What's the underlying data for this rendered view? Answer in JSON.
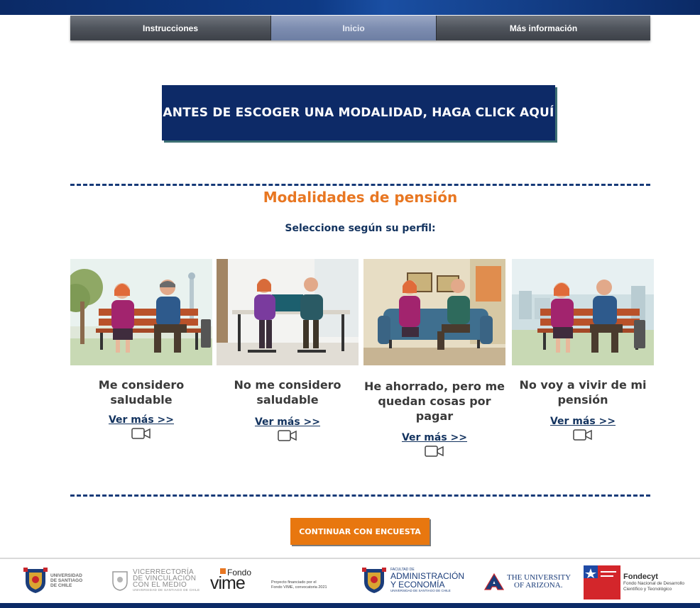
{
  "nav": {
    "items": [
      {
        "label": "Instrucciones"
      },
      {
        "label": "Inicio"
      },
      {
        "label": "Más información"
      }
    ],
    "active_index": 1
  },
  "cta_top": {
    "label": "ANTES DE ESCOGER UNA MODALIDAD, HAGA CLICK AQUÍ"
  },
  "section": {
    "title": "Modalidades de pensión",
    "subtitle": "Seleccione según su perfil:"
  },
  "cards": [
    {
      "title": "Me considero saludable",
      "link": "Ver más >>",
      "icon": "video-camera-icon"
    },
    {
      "title": "No me considero saludable",
      "link": "Ver más >>",
      "icon": "video-camera-icon"
    },
    {
      "title": "He ahorrado, pero me quedan cosas por pagar",
      "link": "Ver más >>",
      "icon": "video-camera-icon"
    },
    {
      "title": "No voy a vivir de mi pensión",
      "link": "Ver más >>",
      "icon": "video-camera-icon"
    }
  ],
  "cta_bottom": {
    "label": "CONTINUAR CON ENCUESTA"
  },
  "footer": {
    "usach": {
      "line1": "UNIVERSIDAD",
      "line2": "DE SANTIAGO",
      "line3": "DE CHILE"
    },
    "vime_vice": {
      "line1": "VICERRECTORÍA",
      "line2": "DE VINCULACIÓN",
      "line3": "CON EL MEDIO",
      "line4": "UNIVERSIDAD DE SANTIAGO DE CHILE"
    },
    "fondo_vime": {
      "logo_small": "Fondo",
      "logo_big": "VIME",
      "note1": "Proyecto financiado por el",
      "note2": "Fondo VIME, convocatoria 2021"
    },
    "fae": {
      "line0": "FACULTAD DE",
      "line1": "ADMINISTRACIÓN",
      "line2": "Y ECONOMÍA",
      "line3": "UNIVERSIDAD DE SANTIAGO DE CHILE"
    },
    "arizona": {
      "line1": "THE UNIVERSITY",
      "line2": "OF ARIZONA."
    },
    "fondecyt": {
      "name": "Fondecyt",
      "line1": "Fondo Nacional de Desarrollo",
      "line2": "Científico y Tecnológico"
    }
  },
  "colors": {
    "navy": "#0d2a67",
    "orange": "#e87722",
    "dash": "#163a78"
  }
}
